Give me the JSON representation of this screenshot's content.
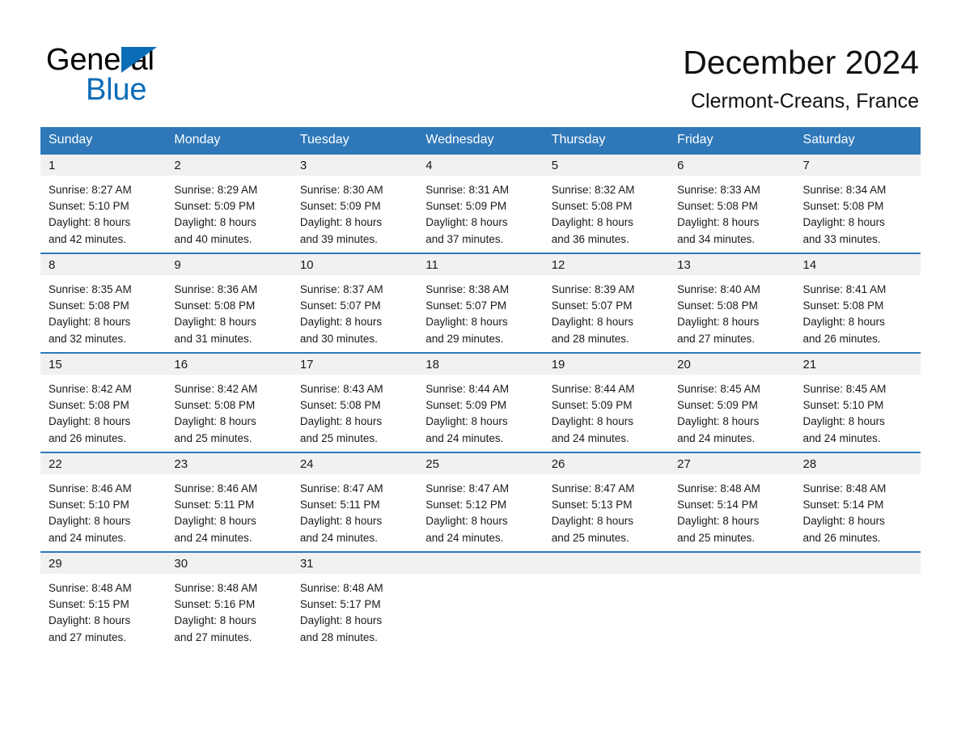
{
  "brand": {
    "name_part1": "General",
    "name_part2": "Blue",
    "accent_color": "#0b6cb7"
  },
  "header": {
    "title": "December 2024",
    "subtitle": "Clermont-Creans, France"
  },
  "theme": {
    "header_row_color": "#2e78b9",
    "day_band_color": "#f1f1f1",
    "row_divider_color": "#2e78b9"
  },
  "weekday_headers": [
    "Sunday",
    "Monday",
    "Tuesday",
    "Wednesday",
    "Thursday",
    "Friday",
    "Saturday"
  ],
  "weeks": [
    [
      {
        "day": "1",
        "sunrise": "Sunrise: 8:27 AM",
        "sunset": "Sunset: 5:10 PM",
        "daylight_line1": "Daylight: 8 hours",
        "daylight_line2": "and 42 minutes."
      },
      {
        "day": "2",
        "sunrise": "Sunrise: 8:29 AM",
        "sunset": "Sunset: 5:09 PM",
        "daylight_line1": "Daylight: 8 hours",
        "daylight_line2": "and 40 minutes."
      },
      {
        "day": "3",
        "sunrise": "Sunrise: 8:30 AM",
        "sunset": "Sunset: 5:09 PM",
        "daylight_line1": "Daylight: 8 hours",
        "daylight_line2": "and 39 minutes."
      },
      {
        "day": "4",
        "sunrise": "Sunrise: 8:31 AM",
        "sunset": "Sunset: 5:09 PM",
        "daylight_line1": "Daylight: 8 hours",
        "daylight_line2": "and 37 minutes."
      },
      {
        "day": "5",
        "sunrise": "Sunrise: 8:32 AM",
        "sunset": "Sunset: 5:08 PM",
        "daylight_line1": "Daylight: 8 hours",
        "daylight_line2": "and 36 minutes."
      },
      {
        "day": "6",
        "sunrise": "Sunrise: 8:33 AM",
        "sunset": "Sunset: 5:08 PM",
        "daylight_line1": "Daylight: 8 hours",
        "daylight_line2": "and 34 minutes."
      },
      {
        "day": "7",
        "sunrise": "Sunrise: 8:34 AM",
        "sunset": "Sunset: 5:08 PM",
        "daylight_line1": "Daylight: 8 hours",
        "daylight_line2": "and 33 minutes."
      }
    ],
    [
      {
        "day": "8",
        "sunrise": "Sunrise: 8:35 AM",
        "sunset": "Sunset: 5:08 PM",
        "daylight_line1": "Daylight: 8 hours",
        "daylight_line2": "and 32 minutes."
      },
      {
        "day": "9",
        "sunrise": "Sunrise: 8:36 AM",
        "sunset": "Sunset: 5:08 PM",
        "daylight_line1": "Daylight: 8 hours",
        "daylight_line2": "and 31 minutes."
      },
      {
        "day": "10",
        "sunrise": "Sunrise: 8:37 AM",
        "sunset": "Sunset: 5:07 PM",
        "daylight_line1": "Daylight: 8 hours",
        "daylight_line2": "and 30 minutes."
      },
      {
        "day": "11",
        "sunrise": "Sunrise: 8:38 AM",
        "sunset": "Sunset: 5:07 PM",
        "daylight_line1": "Daylight: 8 hours",
        "daylight_line2": "and 29 minutes."
      },
      {
        "day": "12",
        "sunrise": "Sunrise: 8:39 AM",
        "sunset": "Sunset: 5:07 PM",
        "daylight_line1": "Daylight: 8 hours",
        "daylight_line2": "and 28 minutes."
      },
      {
        "day": "13",
        "sunrise": "Sunrise: 8:40 AM",
        "sunset": "Sunset: 5:08 PM",
        "daylight_line1": "Daylight: 8 hours",
        "daylight_line2": "and 27 minutes."
      },
      {
        "day": "14",
        "sunrise": "Sunrise: 8:41 AM",
        "sunset": "Sunset: 5:08 PM",
        "daylight_line1": "Daylight: 8 hours",
        "daylight_line2": "and 26 minutes."
      }
    ],
    [
      {
        "day": "15",
        "sunrise": "Sunrise: 8:42 AM",
        "sunset": "Sunset: 5:08 PM",
        "daylight_line1": "Daylight: 8 hours",
        "daylight_line2": "and 26 minutes."
      },
      {
        "day": "16",
        "sunrise": "Sunrise: 8:42 AM",
        "sunset": "Sunset: 5:08 PM",
        "daylight_line1": "Daylight: 8 hours",
        "daylight_line2": "and 25 minutes."
      },
      {
        "day": "17",
        "sunrise": "Sunrise: 8:43 AM",
        "sunset": "Sunset: 5:08 PM",
        "daylight_line1": "Daylight: 8 hours",
        "daylight_line2": "and 25 minutes."
      },
      {
        "day": "18",
        "sunrise": "Sunrise: 8:44 AM",
        "sunset": "Sunset: 5:09 PM",
        "daylight_line1": "Daylight: 8 hours",
        "daylight_line2": "and 24 minutes."
      },
      {
        "day": "19",
        "sunrise": "Sunrise: 8:44 AM",
        "sunset": "Sunset: 5:09 PM",
        "daylight_line1": "Daylight: 8 hours",
        "daylight_line2": "and 24 minutes."
      },
      {
        "day": "20",
        "sunrise": "Sunrise: 8:45 AM",
        "sunset": "Sunset: 5:09 PM",
        "daylight_line1": "Daylight: 8 hours",
        "daylight_line2": "and 24 minutes."
      },
      {
        "day": "21",
        "sunrise": "Sunrise: 8:45 AM",
        "sunset": "Sunset: 5:10 PM",
        "daylight_line1": "Daylight: 8 hours",
        "daylight_line2": "and 24 minutes."
      }
    ],
    [
      {
        "day": "22",
        "sunrise": "Sunrise: 8:46 AM",
        "sunset": "Sunset: 5:10 PM",
        "daylight_line1": "Daylight: 8 hours",
        "daylight_line2": "and 24 minutes."
      },
      {
        "day": "23",
        "sunrise": "Sunrise: 8:46 AM",
        "sunset": "Sunset: 5:11 PM",
        "daylight_line1": "Daylight: 8 hours",
        "daylight_line2": "and 24 minutes."
      },
      {
        "day": "24",
        "sunrise": "Sunrise: 8:47 AM",
        "sunset": "Sunset: 5:11 PM",
        "daylight_line1": "Daylight: 8 hours",
        "daylight_line2": "and 24 minutes."
      },
      {
        "day": "25",
        "sunrise": "Sunrise: 8:47 AM",
        "sunset": "Sunset: 5:12 PM",
        "daylight_line1": "Daylight: 8 hours",
        "daylight_line2": "and 24 minutes."
      },
      {
        "day": "26",
        "sunrise": "Sunrise: 8:47 AM",
        "sunset": "Sunset: 5:13 PM",
        "daylight_line1": "Daylight: 8 hours",
        "daylight_line2": "and 25 minutes."
      },
      {
        "day": "27",
        "sunrise": "Sunrise: 8:48 AM",
        "sunset": "Sunset: 5:14 PM",
        "daylight_line1": "Daylight: 8 hours",
        "daylight_line2": "and 25 minutes."
      },
      {
        "day": "28",
        "sunrise": "Sunrise: 8:48 AM",
        "sunset": "Sunset: 5:14 PM",
        "daylight_line1": "Daylight: 8 hours",
        "daylight_line2": "and 26 minutes."
      }
    ],
    [
      {
        "day": "29",
        "sunrise": "Sunrise: 8:48 AM",
        "sunset": "Sunset: 5:15 PM",
        "daylight_line1": "Daylight: 8 hours",
        "daylight_line2": "and 27 minutes."
      },
      {
        "day": "30",
        "sunrise": "Sunrise: 8:48 AM",
        "sunset": "Sunset: 5:16 PM",
        "daylight_line1": "Daylight: 8 hours",
        "daylight_line2": "and 27 minutes."
      },
      {
        "day": "31",
        "sunrise": "Sunrise: 8:48 AM",
        "sunset": "Sunset: 5:17 PM",
        "daylight_line1": "Daylight: 8 hours",
        "daylight_line2": "and 28 minutes."
      },
      {
        "day": "",
        "sunrise": "",
        "sunset": "",
        "daylight_line1": "",
        "daylight_line2": ""
      },
      {
        "day": "",
        "sunrise": "",
        "sunset": "",
        "daylight_line1": "",
        "daylight_line2": ""
      },
      {
        "day": "",
        "sunrise": "",
        "sunset": "",
        "daylight_line1": "",
        "daylight_line2": ""
      },
      {
        "day": "",
        "sunrise": "",
        "sunset": "",
        "daylight_line1": "",
        "daylight_line2": ""
      }
    ]
  ]
}
